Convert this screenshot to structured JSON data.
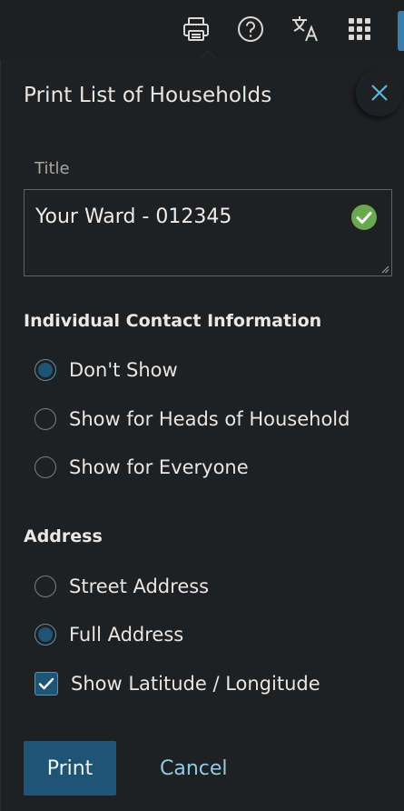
{
  "topbar": {
    "icons": [
      "printer-icon",
      "help-icon",
      "translate-icon",
      "apps-grid-icon"
    ]
  },
  "dialog": {
    "title": "Print List of Households",
    "title_field": {
      "label": "Title",
      "value": "Your Ward - 012345"
    },
    "contact_section": {
      "heading": "Individual Contact Information",
      "options": [
        {
          "label": "Don't Show",
          "selected": true
        },
        {
          "label": "Show for Heads of Household",
          "selected": false
        },
        {
          "label": "Show for Everyone",
          "selected": false
        }
      ]
    },
    "address_section": {
      "heading": "Address",
      "options": [
        {
          "label": "Street Address",
          "selected": false
        },
        {
          "label": "Full Address",
          "selected": true
        }
      ],
      "latlong_checkbox": {
        "label": "Show Latitude / Longitude",
        "checked": true
      }
    },
    "print_label": "Print",
    "cancel_label": "Cancel"
  },
  "colors": {
    "background": "#1f2022",
    "accent": "#1e5577",
    "link": "#8fcbe8",
    "valid_check": "#6aa84f"
  }
}
